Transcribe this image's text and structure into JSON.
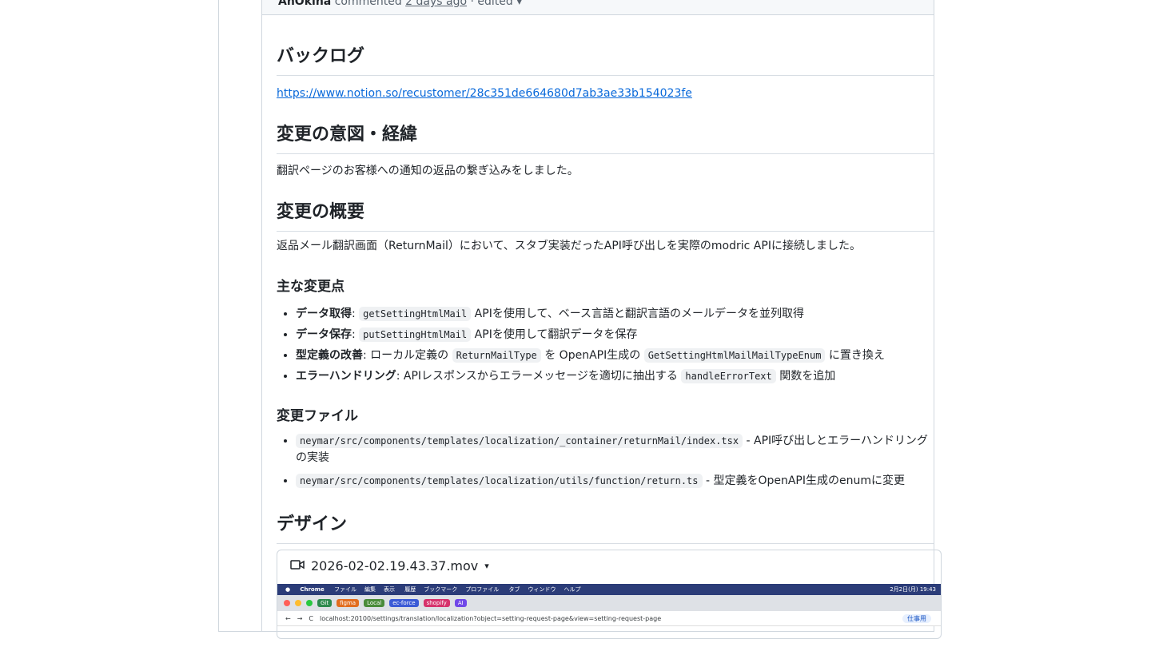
{
  "comment": {
    "author": "AnOkina",
    "action": "commented",
    "time": "2 days ago",
    "edited": "· edited ▾"
  },
  "sections": {
    "backlog_heading": "バックログ",
    "backlog_link": "https://www.notion.so/recustomer/28c351de664680d7ab3ae33b154023fe",
    "intent_heading": "変更の意図・経緯",
    "intent_text": "翻訳ページのお客様への通知の返品の繋ぎ込みをしました。",
    "overview_heading": "変更の概要",
    "overview_text": "返品メール翻訳画面（ReturnMail）において、スタブ実装だったAPI呼び出しを実際のmodric APIに接続しました。",
    "main_changes_heading": "主な変更点",
    "changes": [
      {
        "label": "データ取得",
        "sep": ": ",
        "code1": "getSettingHtmlMail",
        "text1": " APIを使用して、ベース言語と翻訳言語のメールデータを並列取得",
        "code2": "",
        "text2": ""
      },
      {
        "label": "データ保存",
        "sep": ": ",
        "code1": "putSettingHtmlMail",
        "text1": " APIを使用して翻訳データを保存",
        "code2": "",
        "text2": ""
      },
      {
        "label": "型定義の改善",
        "sep": ": ローカル定義の ",
        "code1": "ReturnMailType",
        "text1": " を OpenAPI生成の ",
        "code2": "GetSettingHtmlMailMailTypeEnum",
        "text2": " に置き換え"
      },
      {
        "label": "エラーハンドリング",
        "sep": ": APIレスポンスからエラーメッセージを適切に抽出する ",
        "code1": "handleErrorText",
        "text1": " 関数を追加",
        "code2": "",
        "text2": ""
      }
    ],
    "files_heading": "変更ファイル",
    "files": [
      {
        "path": "neymar/src/components/templates/localization/_container/returnMail/index.tsx",
        "desc": " - API呼び出しとエラーハンドリングの実装"
      },
      {
        "path": "neymar/src/components/templates/localization/utils/function/return.ts",
        "desc": " - 型定義をOpenAPI生成のenumに変更"
      }
    ],
    "design_heading": "デザイン"
  },
  "video": {
    "filename": "2026-02-02.19.43.37.mov",
    "icon": "video-camera-icon",
    "menubar": [
      "Chrome",
      "ファイル",
      "編集",
      "表示",
      "履歴",
      "ブックマーク",
      "プロファイル",
      "タブ",
      "ウィンドウ",
      "ヘルプ"
    ],
    "clock": "2月2日(月) 19:43",
    "tabs": [
      "Git",
      "figma",
      "Local",
      "ec-force",
      "shopify",
      "AI"
    ],
    "url": "localhost:20100/settings/translation/localization?object=setting-request-page&view=setting-request-page",
    "work_label": "仕事用"
  },
  "colors": {
    "link": "#0969da",
    "border": "#d0d7de",
    "code_bg": "#eff1f3"
  }
}
